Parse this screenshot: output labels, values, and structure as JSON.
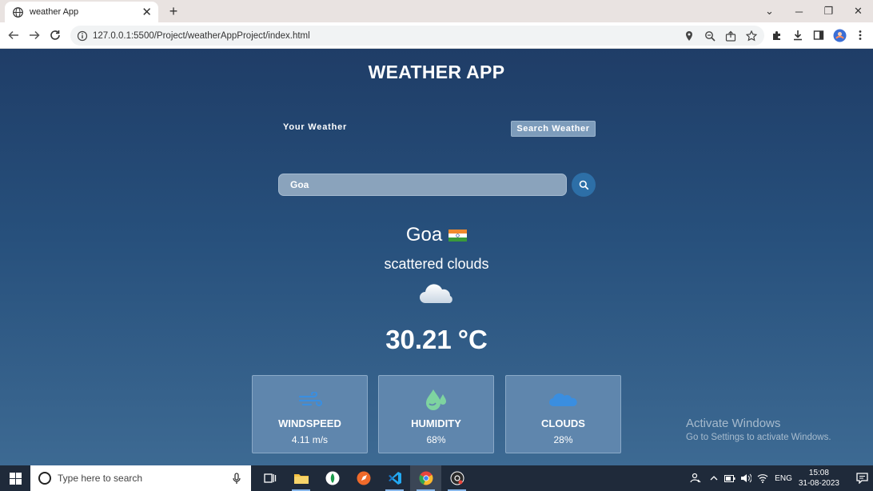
{
  "browser": {
    "tab_title": "weather App",
    "tab_close": "✕",
    "new_tab": "+",
    "url": "127.0.0.1:5500/Project/weatherAppProject/index.html",
    "window_controls": [
      "⌄",
      "─",
      "❐",
      "✕"
    ]
  },
  "app": {
    "title": "WEATHER APP",
    "your_weather_label": "Your Weather",
    "search_weather_label": "Search Weather",
    "search_value": "Goa",
    "city": "Goa",
    "flag": "india-flag-icon",
    "condition": "scattered clouds",
    "temp_value": "30.21",
    "temp_unit": "°C",
    "stats": [
      {
        "label": "WINDSPEED",
        "value": "4.11 m/s",
        "icon": "wind-icon"
      },
      {
        "label": "HUMIDITY",
        "value": "68%",
        "icon": "humidity-icon"
      },
      {
        "label": "CLOUDS",
        "value": "28%",
        "icon": "cloud-icon"
      }
    ],
    "accent": "#2d6fa7"
  },
  "watermark": {
    "title": "Activate Windows",
    "subtitle": "Go to Settings to activate Windows."
  },
  "taskbar": {
    "search_placeholder": "Type here to search",
    "language": "ENG",
    "time": "15:08",
    "date": "31-08-2023"
  }
}
